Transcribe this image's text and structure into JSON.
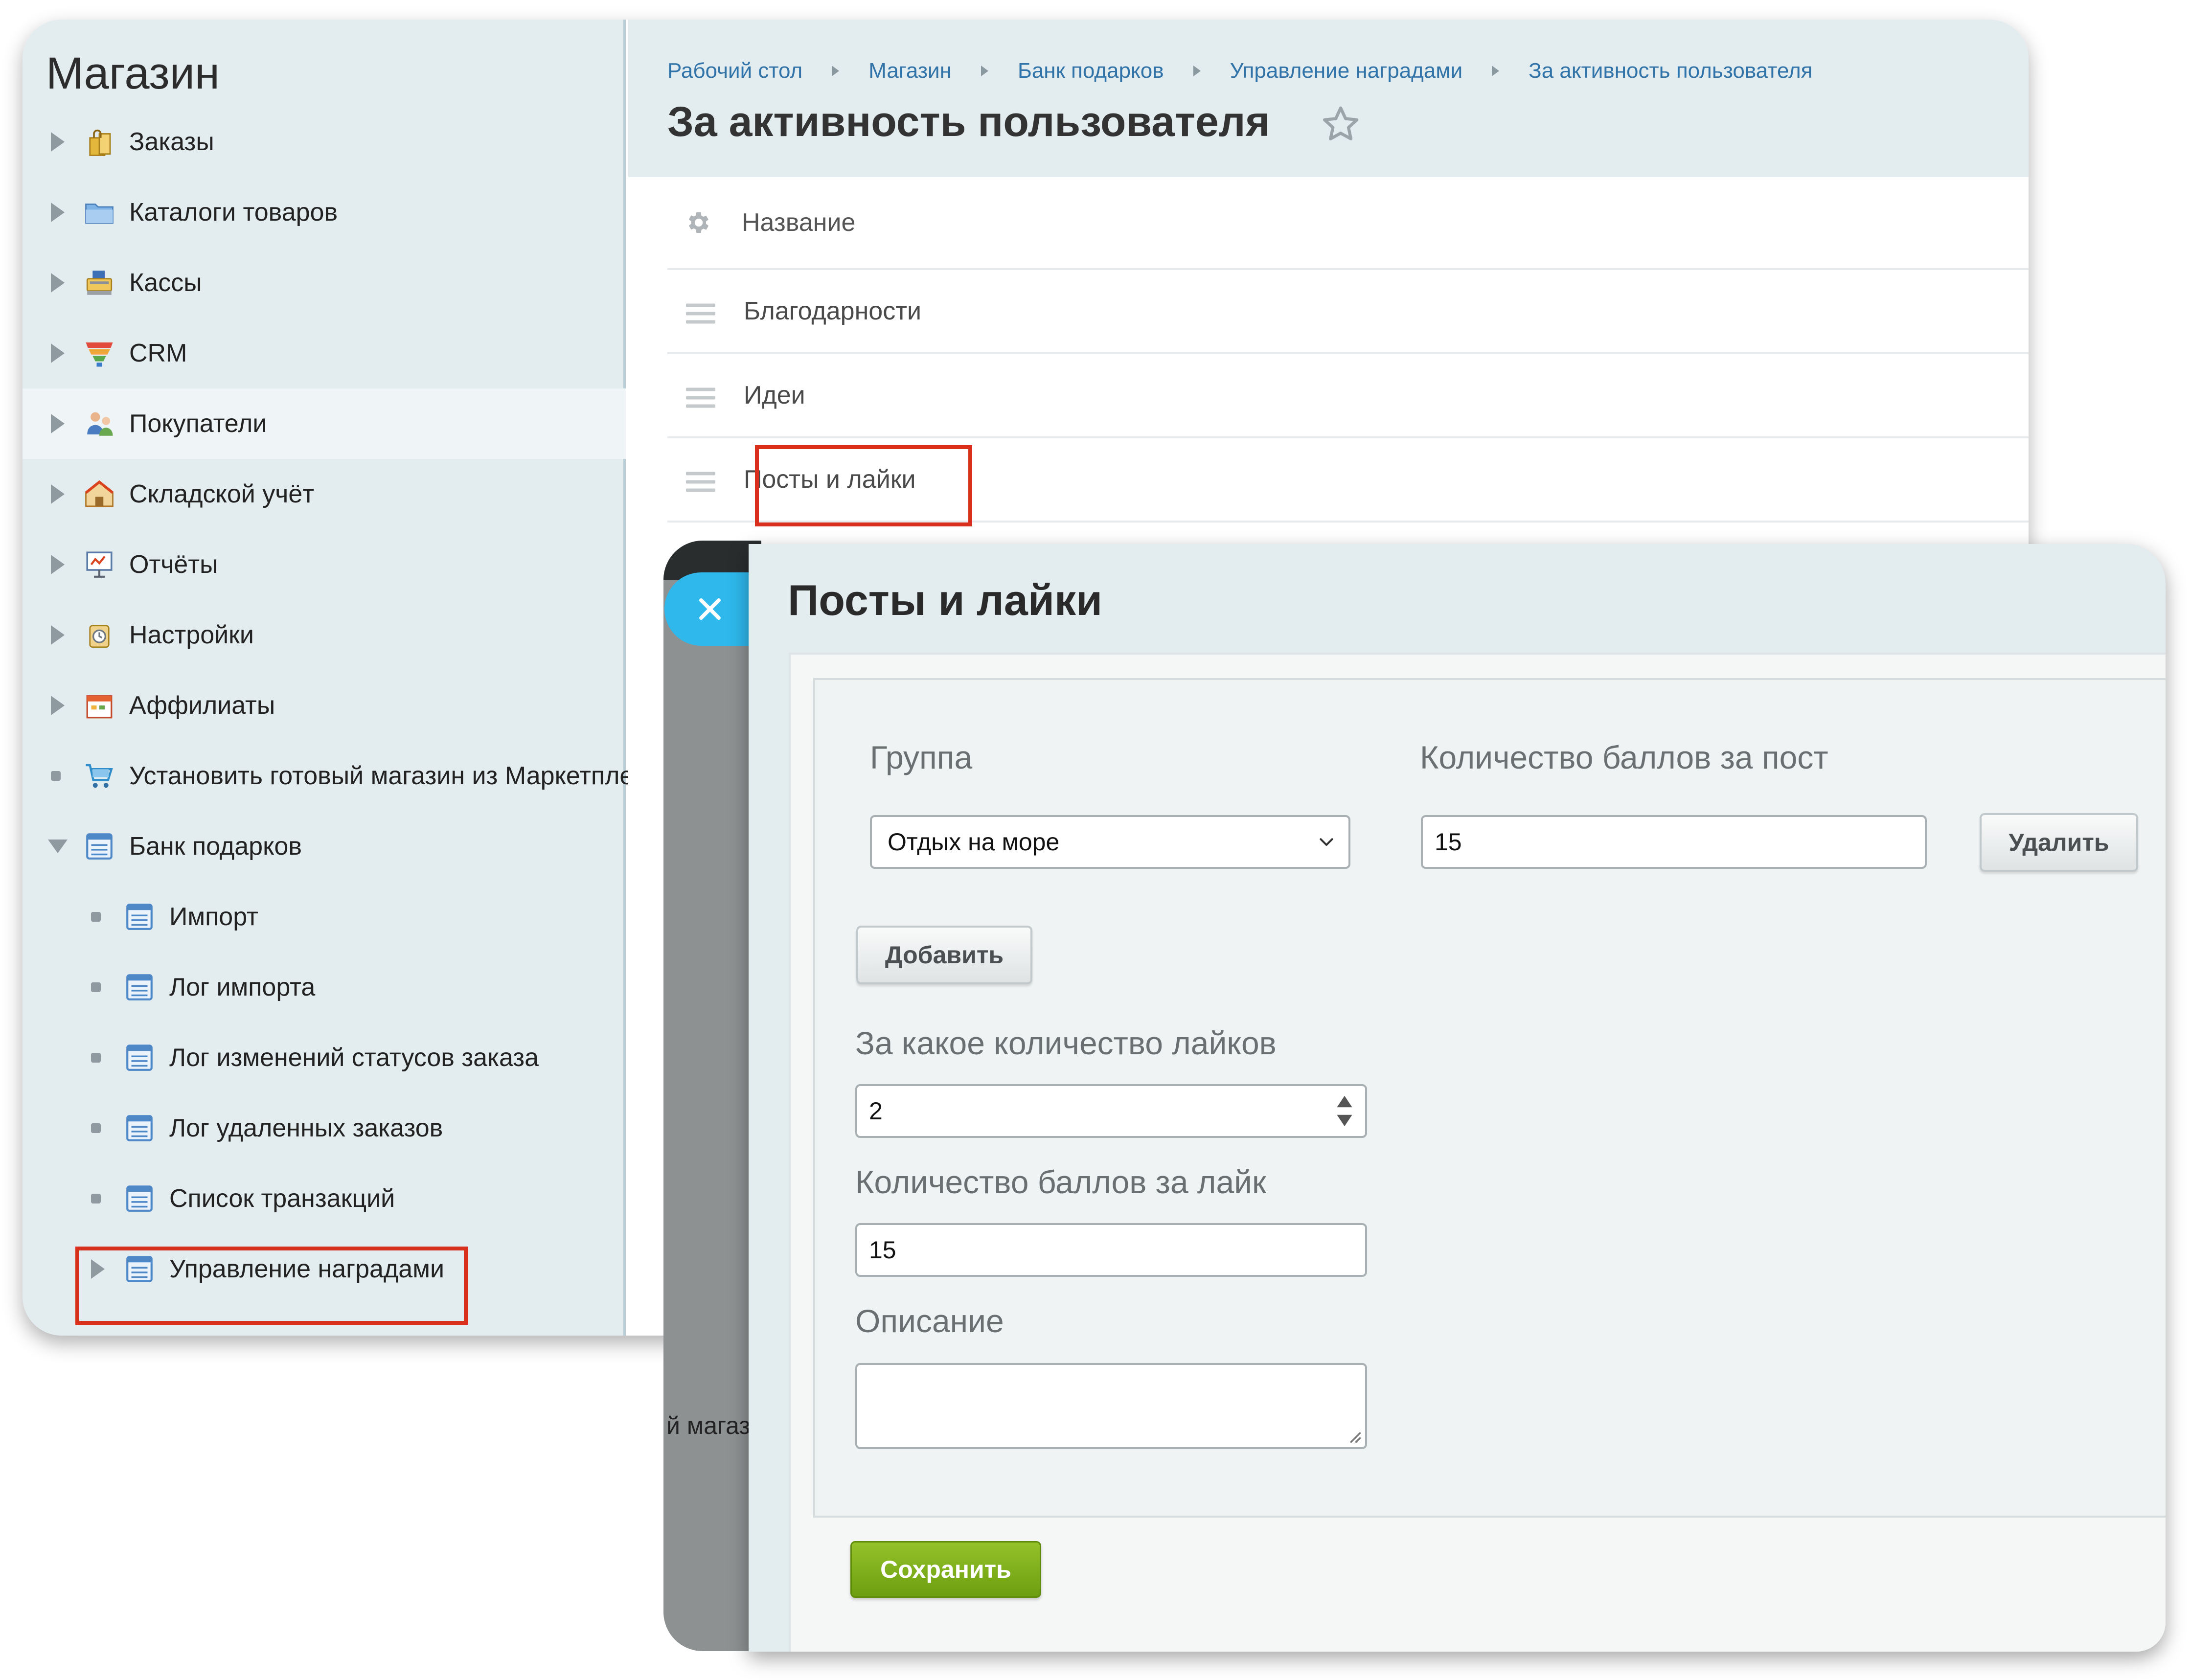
{
  "sidebar": {
    "title": "Магазин",
    "items": [
      {
        "label": "Заказы",
        "icon": "shopping-bags-icon",
        "marker": "arrow-right"
      },
      {
        "label": "Каталоги товаров",
        "icon": "folder-icon",
        "marker": "arrow-right"
      },
      {
        "label": "Кассы",
        "icon": "cash-register-icon",
        "marker": "arrow-right"
      },
      {
        "label": "CRM",
        "icon": "funnel-icon",
        "marker": "arrow-right"
      },
      {
        "label": "Покупатели",
        "icon": "customers-icon",
        "marker": "arrow-right"
      },
      {
        "label": "Складской учёт",
        "icon": "warehouse-icon",
        "marker": "arrow-right"
      },
      {
        "label": "Отчёты",
        "icon": "report-board-icon",
        "marker": "arrow-right"
      },
      {
        "label": "Настройки",
        "icon": "settings-icon",
        "marker": "arrow-right"
      },
      {
        "label": "Аффилиаты",
        "icon": "calendar-icon",
        "marker": "arrow-right"
      },
      {
        "label": "Установить готовый магазин из Маркетплейс",
        "icon": "cart-icon",
        "marker": "bullet"
      },
      {
        "label": "Банк подарков",
        "icon": "list-page-icon",
        "marker": "arrow-down"
      },
      {
        "label": "Импорт",
        "icon": "list-page-icon",
        "marker": "bullet"
      },
      {
        "label": "Лог импорта",
        "icon": "list-page-icon",
        "marker": "bullet"
      },
      {
        "label": "Лог изменений статусов заказа",
        "icon": "list-page-icon",
        "marker": "bullet"
      },
      {
        "label": "Лог удаленных заказов",
        "icon": "list-page-icon",
        "marker": "bullet"
      },
      {
        "label": "Список транзакций",
        "icon": "list-page-icon",
        "marker": "bullet"
      },
      {
        "label": "Управление наградами",
        "icon": "list-page-icon",
        "marker": "arrow-right"
      }
    ]
  },
  "breadcrumb": [
    "Рабочий стол",
    "Магазин",
    "Банк подарков",
    "Управление наградами",
    "За активность пользователя"
  ],
  "page": {
    "title": "За активность пользователя",
    "column_header": "Название",
    "rows": [
      "Благодарности",
      "Идеи",
      "Посты и лайки"
    ]
  },
  "overlay": {
    "fragment_top": "ге",
    "fragment_bottom": "й магаз"
  },
  "panel": {
    "title": "Посты и лайки",
    "group_label": "Группа",
    "group_selected": "Отдых на море",
    "points_per_post_label": "Количество баллов за пост",
    "points_per_post_value": "15",
    "delete_label": "Удалить",
    "add_label": "Добавить",
    "likes_count_label": "За какое количество лайков",
    "likes_count_value": "2",
    "points_per_like_label": "Количество баллов за лайк",
    "points_per_like_value": "15",
    "description_label": "Описание",
    "description_value": "",
    "save_label": "Сохранить"
  },
  "colors": {
    "sidebar_bg": "#e3ecef",
    "link": "#2f73a8",
    "highlight_box": "#d9301e",
    "close_button": "#2fb8ec",
    "save_button": "#7aab17"
  }
}
